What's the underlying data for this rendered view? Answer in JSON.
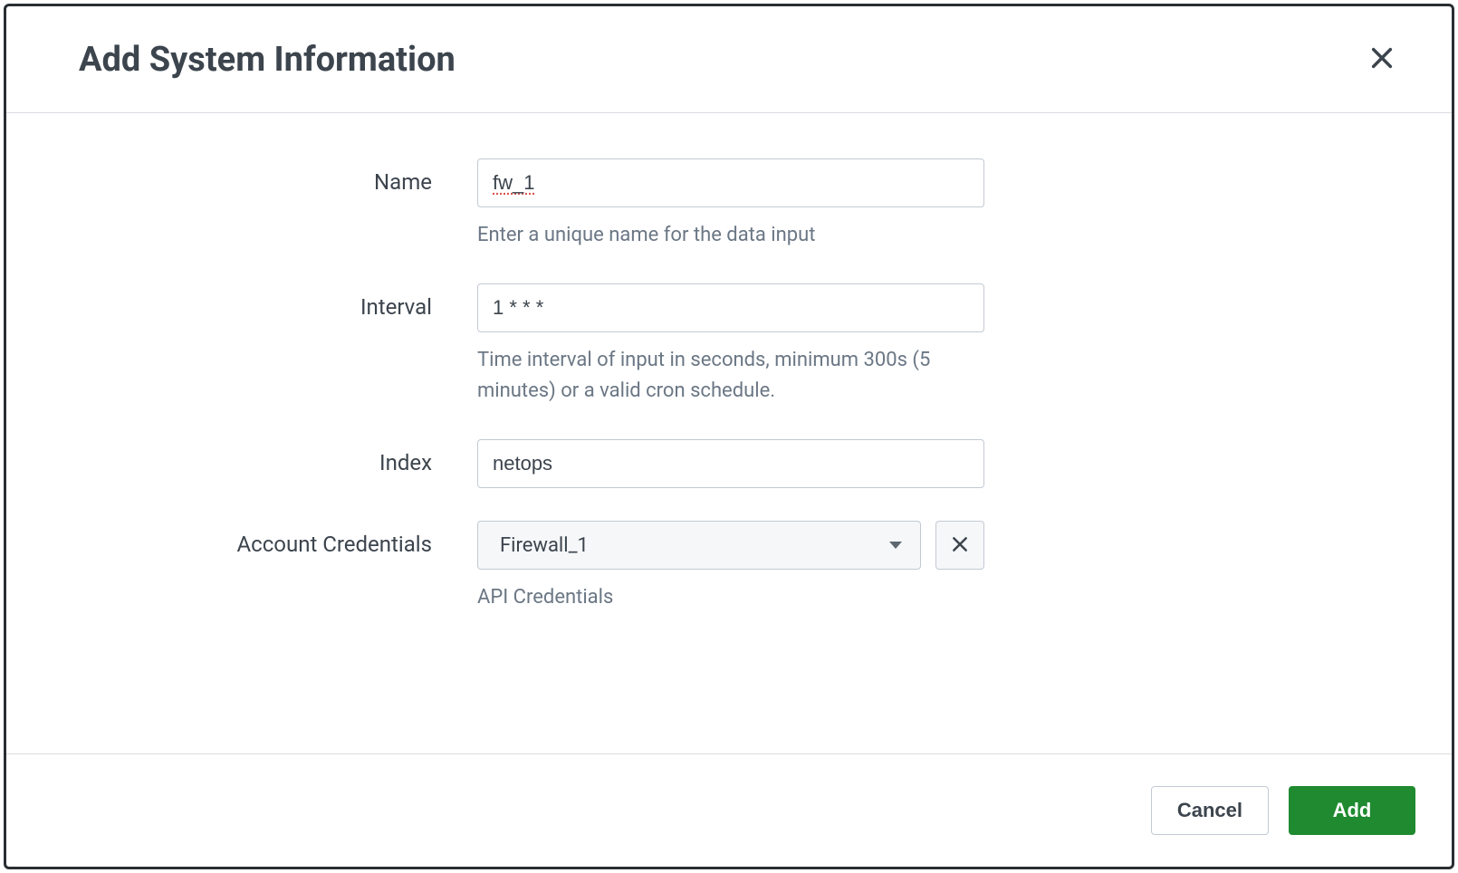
{
  "modal": {
    "title": "Add System Information"
  },
  "form": {
    "name": {
      "label": "Name",
      "value": "fw_1",
      "help": "Enter a unique name for the data input"
    },
    "interval": {
      "label": "Interval",
      "value": "1 * * *",
      "help": "Time interval of input in seconds, minimum 300s (5 minutes) or a valid cron schedule."
    },
    "index": {
      "label": "Index",
      "value": "netops"
    },
    "account": {
      "label": "Account Credentials",
      "value": "Firewall_1",
      "help": "API Credentials"
    }
  },
  "footer": {
    "cancel": "Cancel",
    "add": "Add"
  }
}
